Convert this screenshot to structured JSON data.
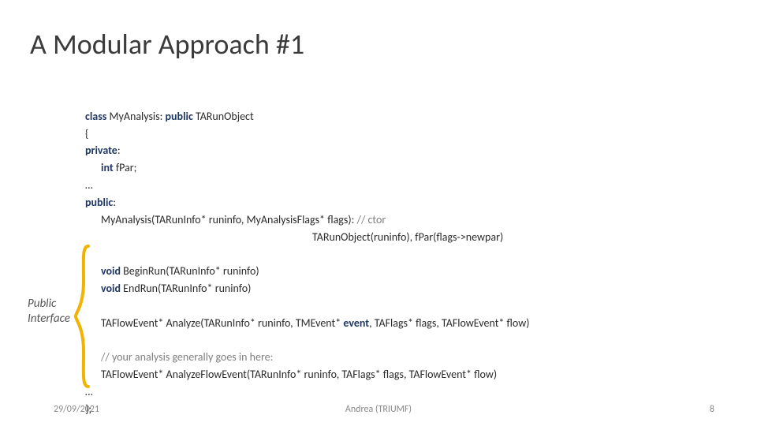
{
  "title": "A Modular Approach #1",
  "label_line1": "Public",
  "label_line2": "Interface",
  "code": {
    "kw_class": "class",
    "classdecl": " MyAnalysis: ",
    "kw_public_inh": "public",
    "classbase": " TARunObject",
    "lbrace": "{",
    "kw_private": "private",
    "colon1": ":",
    "kw_int": "int",
    "fpar": " fPar;",
    "ell1": "…",
    "kw_public": "public",
    "colon2": ":",
    "ctor": "MyAnalysis(TARunInfo* runinfo, MyAnalysisFlags* flags): ",
    "ctor_cmt": "// ctor",
    "ctor_init_pad": "                                                                                           ",
    "ctor_init": "TARunObject(runinfo), fPar(flags->newpar)",
    "kw_void1": "void",
    "beginrun": " BeginRun(TARunInfo* runinfo)",
    "kw_void2": "void",
    "endrun": " EndRun(TARunInfo* runinfo)",
    "analyze_pre": "TAFlowEvent* Analyze(TARunInfo* runinfo, TMEvent* ",
    "kw_event": "event",
    "analyze_post": ", TAFlags* flags, TAFlowEvent* flow)",
    "cmt2": "// your analysis generally goes in here:",
    "analyzeflow": "TAFlowEvent* AnalyzeFlowEvent(TARunInfo* runinfo, TAFlags* flags, TAFlowEvent* flow)",
    "ell2": "…",
    "rbrace": "};"
  },
  "footer": {
    "date": "29/09/2021",
    "center": "Andrea (TRIUMF)",
    "page": "8"
  }
}
